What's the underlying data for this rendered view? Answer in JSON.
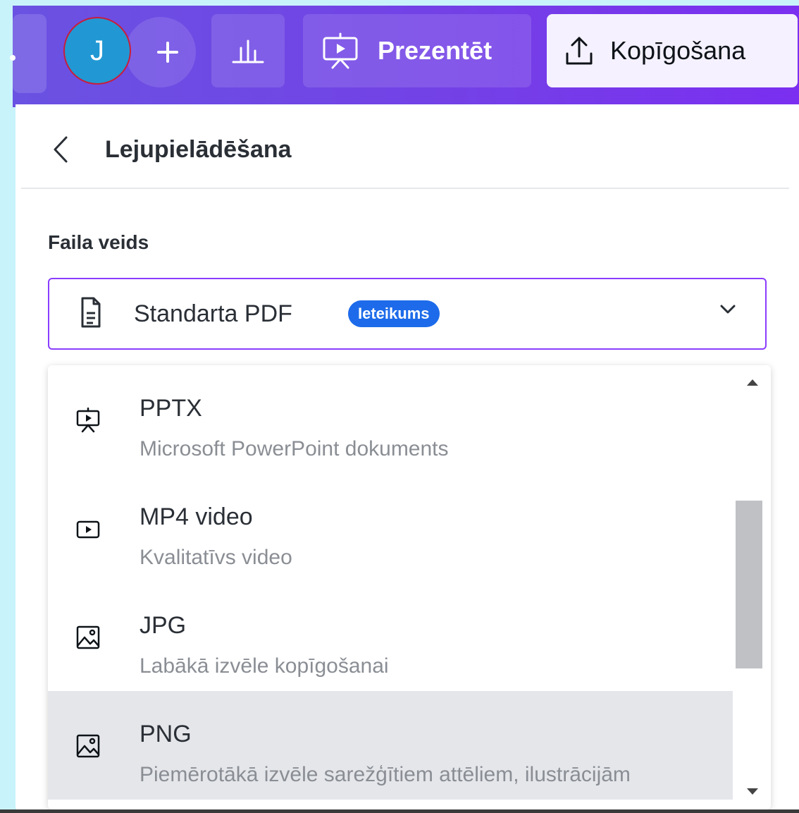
{
  "topbar": {
    "avatar_initial": "J",
    "present_label": "Prezentēt",
    "share_label": "Kopīgošana",
    "accent": "#7341e6"
  },
  "panel": {
    "title": "Lejupielādēšana",
    "file_type_label": "Faila veids",
    "selected_value": "Standarta PDF",
    "selected_badge": "Ieteikums",
    "badge_color": "#1d6bea",
    "options": [
      {
        "title": "PPTX",
        "description": "Microsoft PowerPoint dokuments",
        "icon": "presentation-icon"
      },
      {
        "title": "MP4 video",
        "description": "Kvalitatīvs video",
        "icon": "video-icon"
      },
      {
        "title": "JPG",
        "description": "Labākā izvēle kopīgošanai",
        "icon": "image-icon"
      },
      {
        "title": "PNG",
        "description": "Piemērotākā izvēle sarežģītiem attēliem, ilustrācijām",
        "icon": "image-icon",
        "highlighted": true
      }
    ]
  }
}
